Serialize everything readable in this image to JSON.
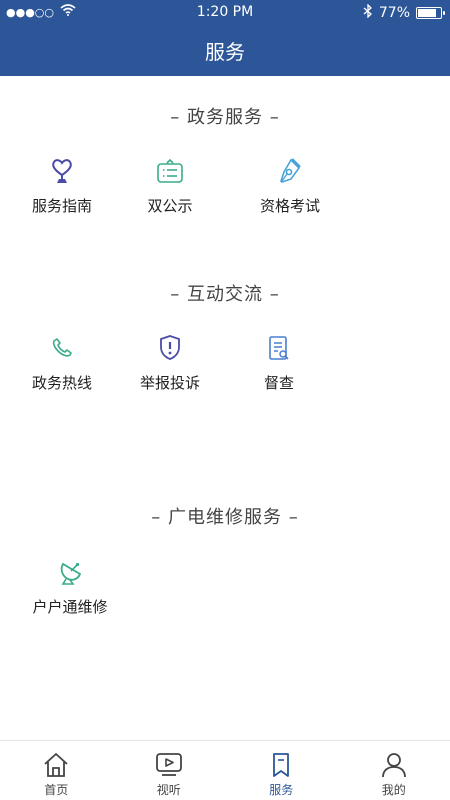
{
  "status_bar": {
    "signal": "●●●○○",
    "time": "1:20 PM",
    "battery_percent_text": "77%",
    "battery_level": 0.77
  },
  "header": {
    "title": "服务"
  },
  "sections": [
    {
      "title": "– 政务服务 –",
      "items": [
        {
          "label": "服务指南",
          "icon": "heart-trophy-icon",
          "color": "#4b4ba8"
        },
        {
          "label": "双公示",
          "icon": "notice-board-icon",
          "color": "#3aab8c"
        },
        {
          "label": "资格考试",
          "icon": "pen-nib-icon",
          "color": "#4aa3d8"
        }
      ]
    },
    {
      "title": "– 互动交流 –",
      "items": [
        {
          "label": "政务热线",
          "icon": "phone-icon",
          "color": "#3aab8c"
        },
        {
          "label": "举报投诉",
          "icon": "shield-alert-icon",
          "color": "#4b4ba8"
        },
        {
          "label": "督查",
          "icon": "document-search-icon",
          "color": "#4a7fd0"
        }
      ]
    },
    {
      "title": "– 广电维修服务 –",
      "items": [
        {
          "label": "户户通维修",
          "icon": "satellite-dish-icon",
          "color": "#3aab8c"
        }
      ]
    }
  ],
  "tab_bar": {
    "tabs": [
      {
        "label": "首页",
        "icon": "home-icon",
        "active": false
      },
      {
        "label": "视听",
        "icon": "tv-play-icon",
        "active": false
      },
      {
        "label": "服务",
        "icon": "bookmark-icon",
        "active": true
      },
      {
        "label": "我的",
        "icon": "user-icon",
        "active": false
      }
    ],
    "active_color": "#2c5697"
  }
}
